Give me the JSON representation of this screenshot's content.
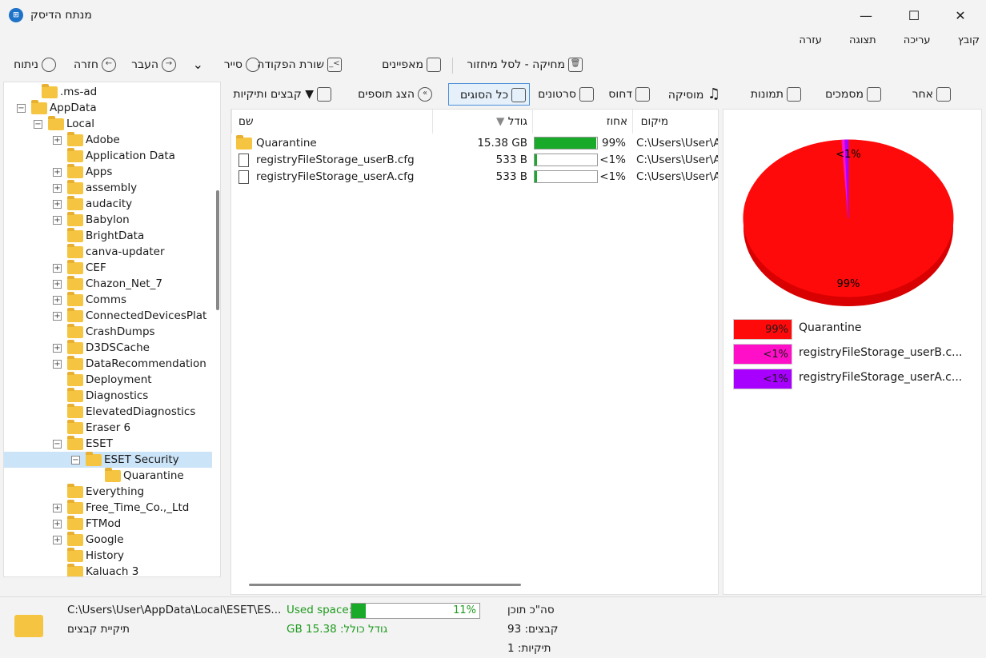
{
  "window": {
    "title": "מנתח הדיסק",
    "app_icon": "disk-analyzer-icon"
  },
  "menu": [
    "קובץ",
    "עריכה",
    "תצוגה",
    "עזרה"
  ],
  "toolbar": {
    "delete": "מחיקה - לסל מיחזור",
    "properties": "מאפיינים",
    "command_line": "שורת הפקודה",
    "explorer": "סייר",
    "forward": "העבר",
    "back": "חזרה",
    "analyze": "ניתוח"
  },
  "filter_tabs": {
    "files_folders": "קבצים ותיקיות",
    "show_addons": "הצג תוספים",
    "all_types": "כל הסוגים",
    "videos": "סרטונים",
    "compressed": "דחוס",
    "music": "מוסיקה",
    "images": "תמונות",
    "documents": "מסמכים",
    "other": "אחר"
  },
  "tree": [
    {
      "label": ".ms-ad"
    },
    {
      "label": "AppData"
    },
    {
      "label": "Local"
    },
    {
      "label": "Adobe"
    },
    {
      "label": "Application Data"
    },
    {
      "label": "Apps"
    },
    {
      "label": "assembly"
    },
    {
      "label": "audacity"
    },
    {
      "label": "Babylon"
    },
    {
      "label": "BrightData"
    },
    {
      "label": "canva-updater"
    },
    {
      "label": "CEF"
    },
    {
      "label": "Chazon_Net_7"
    },
    {
      "label": "Comms"
    },
    {
      "label": "ConnectedDevicesPlat"
    },
    {
      "label": "CrashDumps"
    },
    {
      "label": "D3DSCache"
    },
    {
      "label": "DataRecommendation"
    },
    {
      "label": "Deployment"
    },
    {
      "label": "Diagnostics"
    },
    {
      "label": "ElevatedDiagnostics"
    },
    {
      "label": "Eraser 6"
    },
    {
      "label": "ESET"
    },
    {
      "label": "ESET Security"
    },
    {
      "label": "Quarantine"
    },
    {
      "label": "Everything"
    },
    {
      "label": "Free_Time_Co.,_Ltd"
    },
    {
      "label": "FTMod"
    },
    {
      "label": "Google"
    },
    {
      "label": "History"
    },
    {
      "label": "Kaluach 3"
    }
  ],
  "columns": {
    "name": "שם",
    "size": "גודל",
    "percent": "אחוז",
    "location": "מיקום"
  },
  "files": [
    {
      "name": "Quarantine",
      "size": "15.38 GB",
      "percent": "99%",
      "fill": 0.99,
      "location": "C:\\Users\\User\\Ap"
    },
    {
      "name": "registryFileStorage_userB.cfg",
      "size": "533 B",
      "percent": "<1%",
      "fill": 0.04,
      "location": "C:\\Users\\User\\Ap"
    },
    {
      "name": "registryFileStorage_userA.cfg",
      "size": "533 B",
      "percent": "<1%",
      "fill": 0.04,
      "location": "C:\\Users\\User\\Ap"
    }
  ],
  "chart_data": {
    "type": "pie",
    "labels": [
      "Quarantine",
      "registryFileStorage_userB.c...",
      "registryFileStorage_userA.c..."
    ],
    "values": [
      99,
      0.5,
      0.5
    ],
    "value_labels": [
      "99%",
      "<1%",
      "<1%"
    ],
    "colors": [
      "#ff0a0a",
      "#ff10c8",
      "#a800ff"
    ]
  },
  "status": {
    "path": "C:\\Users\\User\\AppData\\Local\\ESET\\ES...",
    "type": "תיקיית קבצים",
    "used_label": "Used space:",
    "used_percent": "11%",
    "used_fill": 0.11,
    "total_size": "גודל כולל: 15.38 GB",
    "content_total": "סה\"כ תוכן",
    "files_count": "קבצים: 93",
    "folders_count": "תיקיות: 1"
  }
}
